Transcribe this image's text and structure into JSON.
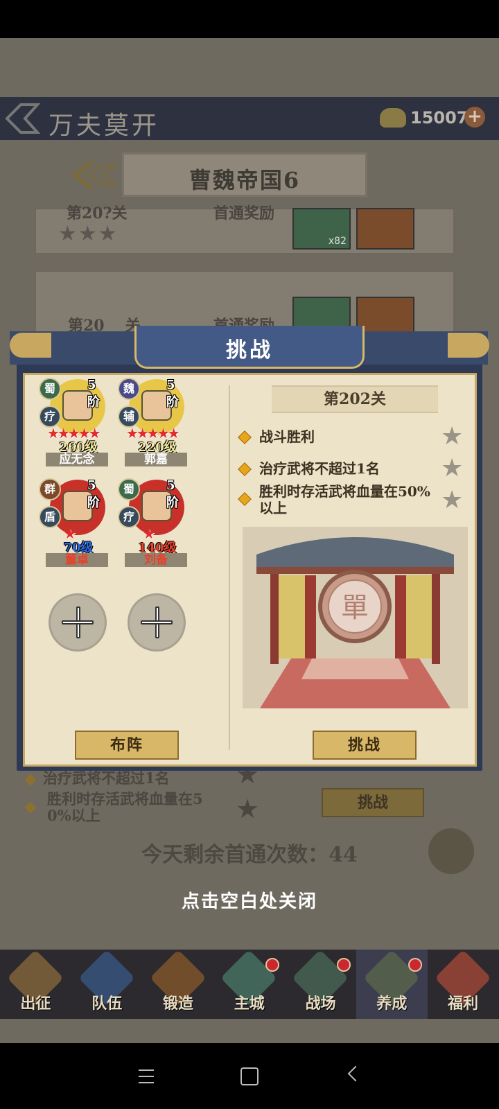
{
  "background": {
    "title": "万夫莫开",
    "currency": {
      "value": "15007",
      "plus": "+"
    },
    "chapter": "曹魏帝国6",
    "cards": [
      {
        "stage": "第20?关",
        "reward_label": "首通奖励",
        "item_count": "x82"
      },
      {
        "stage": "第20",
        "suffix": "关",
        "reward_label": "首通奖励"
      }
    ],
    "objectives": [
      {
        "text": "治疗武将不超过1名"
      },
      {
        "text_line1": "胜利时存活武将血量在5",
        "text_line2": "0%以上"
      }
    ],
    "challenge_button": "挑战",
    "remaining": "今天剩余首通次数：44"
  },
  "close_hint": "点击空白处关闭",
  "dialog": {
    "title": "挑战",
    "stage": "第202关",
    "heroes": [
      {
        "faction": "蜀",
        "role": "疗",
        "rank": "5阶",
        "stars": "★★★★★",
        "level": "260级",
        "name": "应无念",
        "level_color": "#f3e9a0",
        "name_color": "#ffffff",
        "portrait_color": "#e8c748"
      },
      {
        "faction": "魏",
        "role": "辅",
        "rank": "5阶",
        "stars": "★★★★★",
        "level": "220级",
        "name": "郭嘉",
        "level_color": "#f3e9a0",
        "name_color": "#ffffff",
        "portrait_color": "#e8c748"
      },
      {
        "faction": "群",
        "role": "盾",
        "rank": "5阶",
        "stars": "★",
        "level": "70级",
        "name": "董卓",
        "level_color": "#2c6be0",
        "name_color": "#e8402a",
        "portrait_color": "#c8302a"
      },
      {
        "faction": "蜀",
        "role": "疗",
        "rank": "5阶",
        "stars": "★",
        "level": "140级",
        "name": "刘备",
        "level_color": "#e8402a",
        "name_color": "#e8402a",
        "portrait_color": "#c8302a"
      }
    ],
    "objectives": [
      {
        "text": "战斗胜利",
        "star": "★"
      },
      {
        "text": "治疗武将不超过1名",
        "star": "★"
      },
      {
        "text": "胜利时存活武将血量在50%以上",
        "star": "★"
      }
    ],
    "scene_emblem": "單",
    "formation_button": "布阵",
    "challenge_button": "挑战"
  },
  "nav": [
    {
      "label": "出征",
      "color": "#8a6a3c",
      "badge": false
    },
    {
      "label": "队伍",
      "color": "#3a5a8a",
      "badge": false
    },
    {
      "label": "锻造",
      "color": "#8a5a2c",
      "badge": false
    },
    {
      "label": "主城",
      "color": "#4a7a6a",
      "badge": true
    },
    {
      "label": "战场",
      "color": "#4a6a5a",
      "badge": true
    },
    {
      "label": "养成",
      "color": "#5a6a4a",
      "badge": true
    },
    {
      "label": "福利",
      "color": "#a84a3a",
      "badge": false
    }
  ]
}
